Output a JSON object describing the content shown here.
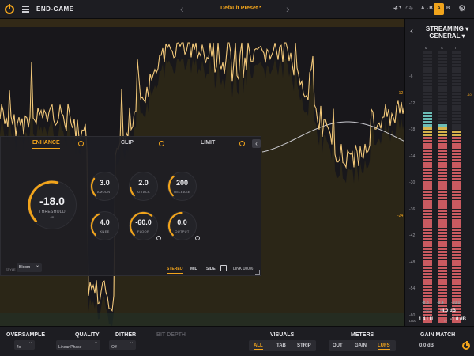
{
  "header": {
    "app_title": "END-GAME",
    "preset_name": "Default Preset *",
    "ab_label": "A→B",
    "a_label": "A",
    "b_label": "B",
    "prev_arrow": "‹",
    "next_arrow": "›",
    "undo_glyph": "↶",
    "redo_glyph": "↷",
    "settings_glyph": "⚙"
  },
  "panel": {
    "tabs": [
      {
        "label": "ENHANCE",
        "active": true
      },
      {
        "label": "CLIP",
        "active": false
      },
      {
        "label": "LIMIT",
        "active": false
      }
    ],
    "collapse_glyph": "‹",
    "knobs": {
      "threshold": {
        "value": "-18.0",
        "label": "THRESHOLD",
        "unit": "dB",
        "fill": 0.55
      },
      "amount": {
        "value": "3.0",
        "label": "AMOUNT",
        "fill": 0.3
      },
      "attack": {
        "value": "2.0",
        "label": "ATTACK",
        "fill": 0.15
      },
      "release": {
        "value": "200",
        "label": "RELEASE",
        "fill": 0.35
      },
      "knee": {
        "value": "4.0",
        "label": "KNEE",
        "fill": 0.4
      },
      "floor": {
        "value": "-60.0",
        "label": "FLOOR",
        "fill": 0.65
      },
      "output": {
        "value": "0.0",
        "label": "OUTPUT",
        "fill": 0.5
      }
    },
    "style_label": "STYLE",
    "style_value": "Bloom",
    "modes": [
      {
        "label": "STEREO",
        "active": true
      },
      {
        "label": "MID",
        "active": false
      },
      {
        "label": "SIDE",
        "active": false
      }
    ],
    "link_label": "LINK 100%"
  },
  "meter": {
    "preset_line1": "STREAMING ▾",
    "preset_line2": "GENERAL ▾",
    "channels": [
      "M",
      "S",
      "I"
    ],
    "scale": [
      "-6",
      "-12",
      "-18",
      "-24",
      "-30",
      "-36",
      "-42",
      "-48",
      "-54",
      "-60"
    ],
    "target": "-10",
    "readouts": [
      "-8.8",
      "-9.4",
      "-10.0"
    ],
    "norm_label": "NORM",
    "norm_value": "-4.0 dB",
    "lra_label": "LRA",
    "lra_value": "1.4 LU",
    "tp_label": "TP",
    "tp_value": "-1.0 dB"
  },
  "visualizer": {
    "scale_labels": [
      "-12",
      "-24"
    ]
  },
  "bottom": {
    "oversample_label": "OVERSAMPLE",
    "oversample_value": "4x",
    "quality_label": "QUALITY",
    "quality_value": "Linear Phase",
    "dither_label": "DITHER",
    "dither_value": "Off",
    "bitdepth_label": "BIT DEPTH",
    "visuals_label": "VISUALS",
    "visuals_options": [
      "ALL",
      "TAB",
      "STRIP"
    ],
    "meters_label": "METERS",
    "meters_options": [
      "OUT",
      "GAIN",
      "LUFS"
    ],
    "gainmatch_label": "GAIN MATCH",
    "gainmatch_value": "0.0 dB"
  },
  "colors": {
    "accent": "#f1a41c",
    "waveform": "#f3c97a",
    "meter_red": "#c95a60",
    "meter_teal": "#6bbcb6",
    "background": "#16161a"
  }
}
